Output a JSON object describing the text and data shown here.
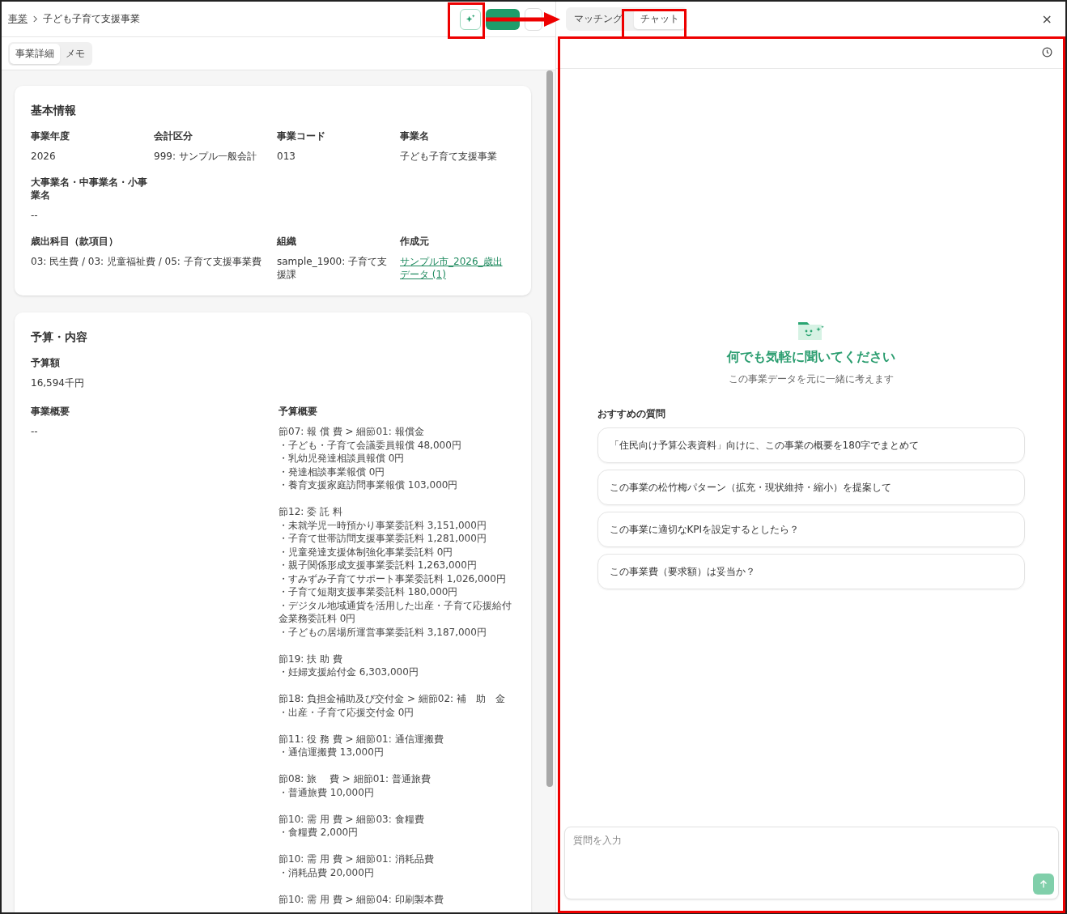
{
  "breadcrumb": [
    {
      "label": "事業",
      "link": true
    },
    {
      "label": "子ども子育て支援事業",
      "link": false
    }
  ],
  "left_tabs": [
    {
      "label": "事業詳細",
      "selected": true
    },
    {
      "label": "メモ",
      "selected": false
    }
  ],
  "basic_info": {
    "title": "基本情報",
    "rows": [
      [
        {
          "label": "事業年度",
          "value": "2026"
        },
        {
          "label": "会計区分",
          "value": "999: サンプル一般会計"
        },
        {
          "label": "事業コード",
          "value": "013"
        },
        {
          "label": "事業名",
          "value": "子ども子育て支援事業"
        }
      ],
      [
        {
          "label": "大事業名・中事業名・小事業名",
          "value": "--"
        }
      ],
      [
        {
          "label": "歳出科目（款項目）",
          "value": "03: 民生費 / 03: 児童福祉費 / 05: 子育て支援事業費",
          "kind": "wide"
        },
        null,
        {
          "label": "組織",
          "value": "sample_1900: 子育て支援課"
        },
        {
          "label": "作成元",
          "value": "サンプル市_2026_歳出データ (1)",
          "kind": "link"
        }
      ]
    ]
  },
  "budget": {
    "title": "予算・内容",
    "amount_label": "予算額",
    "amount": "16,594千円",
    "overview_label": "事業概要",
    "overview": "--",
    "summary_label": "予算概要",
    "summary": [
      {
        "heading": "節07: 報 償 費 > 細節01: 報償金",
        "items": [
          "・子ども・子育て会議委員報償 48,000円",
          "・乳幼児発達相談員報償 0円",
          "・発達相談事業報償 0円",
          "・養育支援家庭訪問事業報償 103,000円"
        ]
      },
      {
        "heading": "節12: 委 託 料",
        "items": [
          "・未就学児一時預かり事業委託料 3,151,000円",
          "・子育て世帯訪問支援事業委託料 1,281,000円",
          "・児童発達支援体制強化事業委託料 0円",
          "・親子関係形成支援事業委託料 1,263,000円",
          "・すみずみ子育てサポート事業委託料 1,026,000円",
          "・子育て短期支援事業委託料 180,000円",
          "・デジタル地域通貨を活用した出産・子育て応援給付金業務委託料 0円",
          "・子どもの居場所運営事業委託料 3,187,000円"
        ]
      },
      {
        "heading": "節19: 扶 助 費",
        "items": [
          "・妊婦支援給付金 6,303,000円"
        ]
      },
      {
        "heading": "節18: 負担金補助及び交付金 > 細節02: 補　助　金",
        "items": [
          "・出産・子育て応援交付金 0円"
        ]
      },
      {
        "heading": "節11: 役 務 費 > 細節01: 通信運搬費",
        "items": [
          "・通信運搬費 13,000円"
        ]
      },
      {
        "heading": "節08: 旅　 費 > 細節01: 普通旅費",
        "items": [
          "・普通旅費 10,000円"
        ]
      },
      {
        "heading": "節10: 需 用 費 > 細節03: 食糧費",
        "items": [
          "・食糧費 2,000円"
        ]
      },
      {
        "heading": "節10: 需 用 費 > 細節01: 消耗品費",
        "items": [
          "・消耗品費 20,000円"
        ]
      },
      {
        "heading": "節10: 需 用 費 > 細節04: 印刷製本費"
      }
    ]
  },
  "close_label": "×",
  "chat_tabs": [
    {
      "label": "マッチング",
      "selected": false
    },
    {
      "label": "チャット",
      "selected": true
    }
  ],
  "chat": {
    "title": "何でも気軽に聞いてください",
    "subtitle": "この事業データを元に一緒に考えます",
    "suggestions_label": "おすすめの質問",
    "suggestions": [
      "「住民向け予算公表資料」向けに、この事業の概要を180字でまとめて",
      "この事業の松竹梅パターン（拡充・現状維持・縮小）を提案して",
      "この事業に適切なKPIを設定するとしたら？",
      "この事業費（要求額）は妥当か？"
    ],
    "input": {
      "placeholder": "質問を入力"
    }
  }
}
